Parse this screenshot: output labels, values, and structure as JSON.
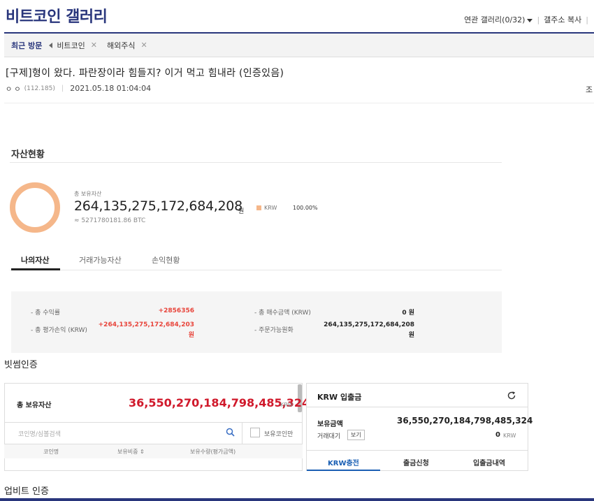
{
  "header": {
    "title": "비트코인 갤러리",
    "related_gallery": "연관 갤러리(0/32)",
    "copy_address": "갤주소 복사"
  },
  "recent": {
    "label": "최근 방문",
    "items": [
      "비트코인",
      "해외주식"
    ],
    "close_glyph": "✕"
  },
  "post": {
    "title": "[구제]형이 왔다. 파란장이라 힘들지? 이거 먹고 힘내라 (인증있음)",
    "author": "ㅇ ㅇ",
    "ip": "(112.185)",
    "date": "2021.05.18 01:04:04",
    "right_fragment": "조"
  },
  "asset": {
    "heading": "자산현황",
    "total_label": "총 보유자산",
    "total_value": "264,135,275,172,684,208",
    "total_unit": "원",
    "legend_label": "KRW",
    "legend_pct": "100.00%",
    "btc_approx": "≈ 5271780181.86 BTC",
    "donut_color": "#f5b78a"
  },
  "tabs": [
    "나의자산",
    "거래가능자산",
    "손익현황"
  ],
  "summary": {
    "profit_rate_label": "- 총 수익률",
    "profit_rate_value": "+2856356",
    "eval_label": "- 총 평가손익 (KRW)",
    "eval_value_line1": "+264,135,275,172,684,203",
    "eval_value_line2": "원",
    "buy_label": "- 총 매수금액 (KRW)",
    "buy_value": "0 원",
    "orderable_label": "- 주문가능원화",
    "orderable_line1": "264,135,275,172,684,208",
    "orderable_line2": "원"
  },
  "bithumb": {
    "heading": "빗썸인증",
    "total_label": "총 보유자산",
    "total_value": "36,550,270,184,798,485,324",
    "total_unit": "KRW",
    "search_placeholder": "코인명/심볼검색",
    "owned_only": "보유코인만",
    "columns": [
      "코인명",
      "보유비중 ⇕",
      "보유수량(평가금액)"
    ]
  },
  "krw_panel": {
    "title": "KRW 입출금",
    "hold_label": "보유금액",
    "hold_value": "36,550,270,184,798,485,324",
    "wait_label": "거래대기",
    "view_button": "보기",
    "wait_value": "0",
    "wait_unit": "KRW",
    "tabs": [
      "KRW충전",
      "출금신청",
      "입출금내역"
    ],
    "accent": "#1a5fb4"
  },
  "upbit": {
    "heading": "업비트 인증"
  }
}
